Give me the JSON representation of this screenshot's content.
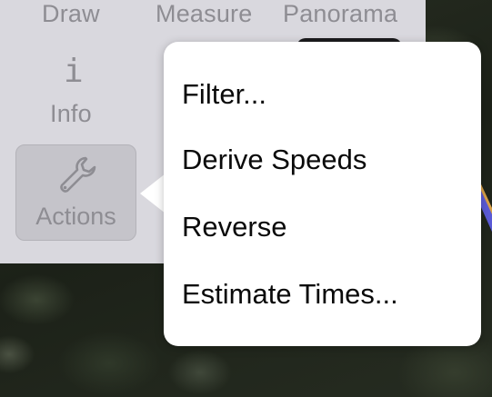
{
  "toolbar": {
    "draw_label": "Draw",
    "measure_label": "Measure",
    "panorama_label": "Panorama",
    "info_label": "Info",
    "info_glyph": "i",
    "actions_label": "Actions"
  },
  "actions_menu": {
    "items": [
      {
        "label": "Filter..."
      },
      {
        "label": "Derive Speeds"
      },
      {
        "label": "Reverse"
      },
      {
        "label": "Estimate Times..."
      }
    ]
  },
  "icons": {
    "info": "info-icon",
    "actions": "wrench-icon"
  },
  "colors": {
    "panel_background": "#d9d8de",
    "selected_button": "#c5c4ca",
    "muted_text": "#8e8d93",
    "menu_background": "#ffffff",
    "menu_text": "#0a0a0a",
    "route_blue": "#5b5bd6",
    "route_orange": "#d9a14a"
  }
}
